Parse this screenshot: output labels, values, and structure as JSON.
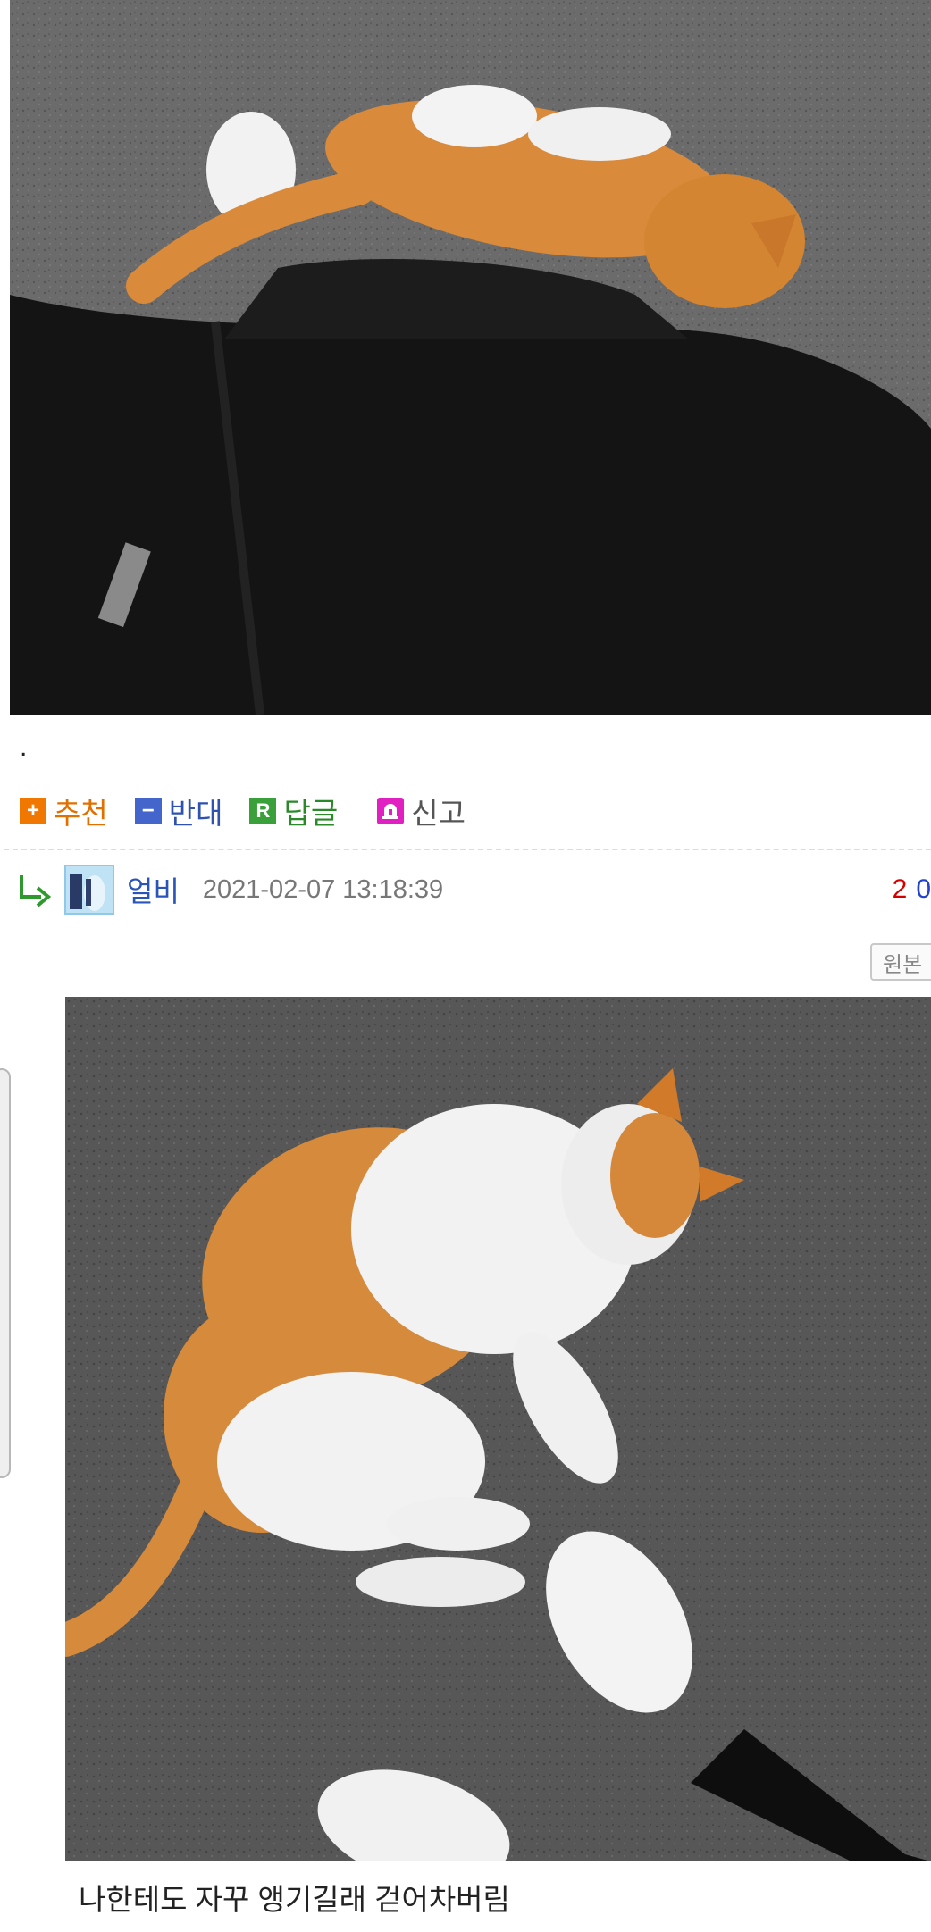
{
  "post": {
    "photo1_alt": "orange and white cat walking between feet",
    "dot_text": "."
  },
  "actions": {
    "recommend": {
      "icon": "plus-icon",
      "label": "추천"
    },
    "oppose": {
      "icon": "minus-icon",
      "label": "반대"
    },
    "reply": {
      "icon": "reply-r-icon",
      "label": "답글"
    },
    "report": {
      "icon": "siren-icon",
      "label": "신고"
    }
  },
  "comment": {
    "nickname": "얼비",
    "date": "2021-02-07 13:18:39",
    "upvotes": "2",
    "downvotes": "0",
    "original_button": "원본",
    "caption": "나한테도 자꾸 앵기길래 걷어차버림"
  },
  "colors": {
    "recommend": "#f07800",
    "oppose": "#4466cc",
    "reply": "#3aa03a",
    "report": "#e020c0",
    "upvote": "#d40000",
    "downvote": "#2244cc"
  }
}
